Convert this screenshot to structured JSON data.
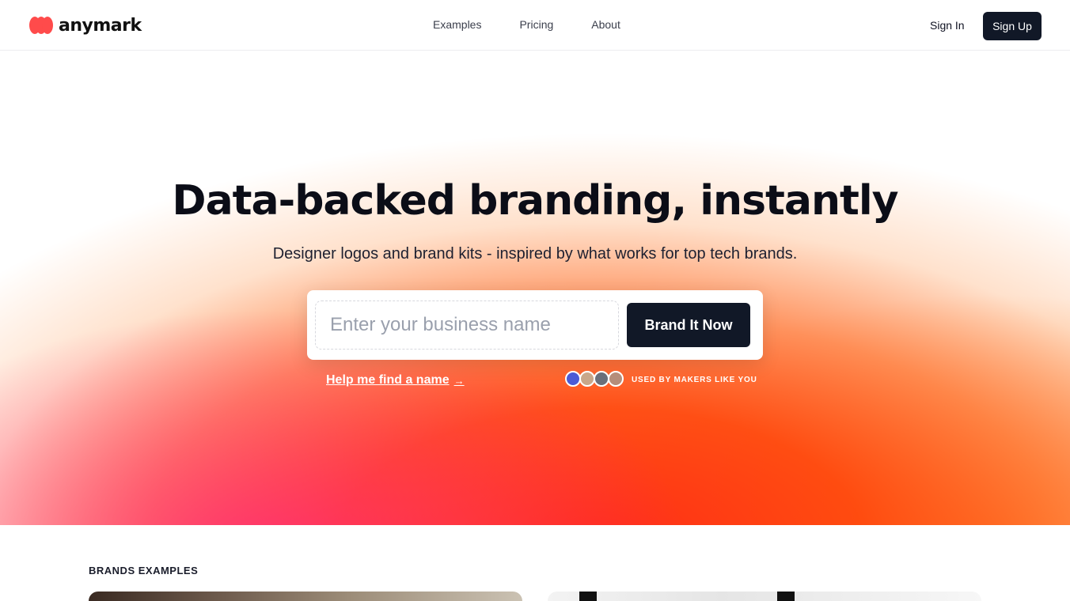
{
  "header": {
    "logo_text": "anymark",
    "nav": [
      "Examples",
      "Pricing",
      "About"
    ],
    "sign_in": "Sign In",
    "sign_up": "Sign Up"
  },
  "hero": {
    "title": "Data-backed branding, instantly",
    "subtitle": "Designer logos and brand kits - inspired by what works for top tech brands.",
    "search_placeholder": "Enter your business name",
    "search_value": "",
    "cta": "Brand It Now",
    "help_link": "Help me find a name",
    "help_icon": "arrow-right-icon",
    "makers_text": "USED BY MAKERS LIKE YOU",
    "avatar_colors": [
      "#4b5bd6",
      "#c9a78a",
      "#6b6f7a",
      "#b58d7a"
    ]
  },
  "brands": {
    "label": "BRANDS EXAMPLES"
  },
  "colors": {
    "brand_red": "#ff4b4b",
    "button_dark": "#111827",
    "gradient_main": "#ff3d14",
    "gradient_pink": "#ff2878"
  }
}
